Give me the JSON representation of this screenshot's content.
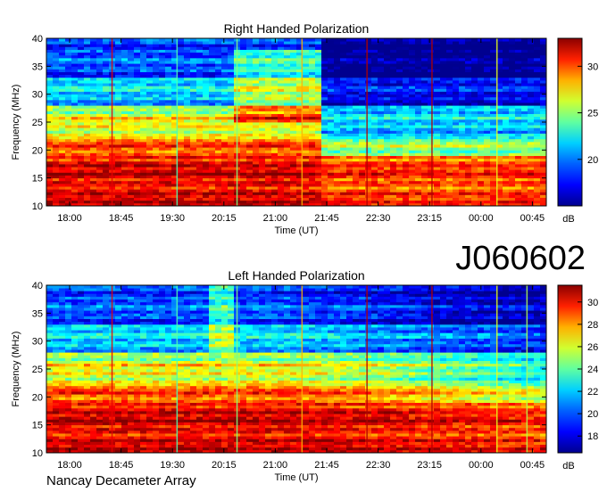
{
  "observation_id": "J060602",
  "footer": "Nancay Decameter Array",
  "chart_data": [
    {
      "type": "heatmap",
      "title": "Right Handed Polarization",
      "xlabel": "Time (UT)",
      "ylabel": "Frequency (MHz)",
      "x_ticks": [
        "18:00",
        "18:45",
        "19:30",
        "20:15",
        "21:00",
        "21:45",
        "22:30",
        "23:15",
        "00:00",
        "00:45"
      ],
      "y_ticks": [
        10,
        15,
        20,
        25,
        30,
        35,
        40
      ],
      "ylim": [
        10,
        40
      ],
      "colorbar": {
        "label": "dB",
        "ticks": [
          20,
          25,
          30
        ],
        "range": [
          15,
          33
        ]
      },
      "regime_change_time": "21:55",
      "dense_emission_interval": [
        "21:00",
        "21:55"
      ]
    },
    {
      "type": "heatmap",
      "title": "Left Handed Polarization",
      "xlabel": "Time (UT)",
      "ylabel": "Frequency (MHz)",
      "x_ticks": [
        "18:00",
        "18:45",
        "19:30",
        "20:15",
        "21:00",
        "21:45",
        "22:30",
        "23:15",
        "00:00",
        "00:45"
      ],
      "y_ticks": [
        10,
        15,
        20,
        25,
        30,
        35,
        40
      ],
      "ylim": [
        10,
        40
      ],
      "colorbar": {
        "label": "dB",
        "ticks": [
          18,
          20,
          22,
          24,
          26,
          28,
          30
        ],
        "range": [
          16.5,
          31.5
        ]
      }
    }
  ],
  "colormap": [
    "#00008f",
    "#0000ff",
    "#0080ff",
    "#00ffff",
    "#80ff80",
    "#ffff00",
    "#ff8000",
    "#ff0000",
    "#800000"
  ]
}
